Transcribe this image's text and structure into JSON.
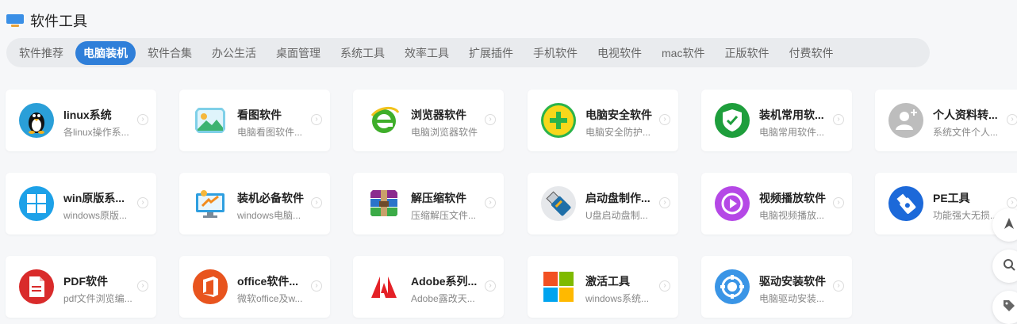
{
  "header": {
    "title": "软件工具",
    "icon": "monitor-icon"
  },
  "tabs": [
    {
      "label": "软件推荐",
      "active": false
    },
    {
      "label": "电脑装机",
      "active": true
    },
    {
      "label": "软件合集",
      "active": false
    },
    {
      "label": "办公生活",
      "active": false
    },
    {
      "label": "桌面管理",
      "active": false
    },
    {
      "label": "系统工具",
      "active": false
    },
    {
      "label": "效率工具",
      "active": false
    },
    {
      "label": "扩展插件",
      "active": false
    },
    {
      "label": "手机软件",
      "active": false
    },
    {
      "label": "电视软件",
      "active": false
    },
    {
      "label": "mac软件",
      "active": false
    },
    {
      "label": "正版软件",
      "active": false
    },
    {
      "label": "付费软件",
      "active": false
    }
  ],
  "cards": [
    {
      "name": "linux系统",
      "desc": "各linux操作系...",
      "icon": "linux-penguin-icon"
    },
    {
      "name": "看图软件",
      "desc": "电脑看图软件...",
      "icon": "image-viewer-icon"
    },
    {
      "name": "浏览器软件",
      "desc": "电脑浏览器软件",
      "icon": "browser-icon"
    },
    {
      "name": "电脑安全软件",
      "desc": "电脑安全防护...",
      "icon": "security-plus-icon"
    },
    {
      "name": "装机常用软...",
      "desc": "电脑常用软件...",
      "icon": "shield-check-icon"
    },
    {
      "name": "个人资料转...",
      "desc": "系统文件个人...",
      "icon": "user-profile-icon"
    },
    {
      "name": "win原版系...",
      "desc": "windows原版...",
      "icon": "windows-icon"
    },
    {
      "name": "装机必备软件",
      "desc": "windows电脑...",
      "icon": "install-essentials-icon"
    },
    {
      "name": "解压缩软件",
      "desc": "压缩解压文件...",
      "icon": "archive-icon"
    },
    {
      "name": "启动盘制作...",
      "desc": "U盘启动盘制...",
      "icon": "usb-drive-icon"
    },
    {
      "name": "视频播放软件",
      "desc": "电脑视频播放...",
      "icon": "video-play-icon"
    },
    {
      "name": "PE工具",
      "desc": "功能强大无损...",
      "icon": "pe-tool-icon"
    },
    {
      "name": "PDF软件",
      "desc": "pdf文件浏览编...",
      "icon": "pdf-icon"
    },
    {
      "name": "office软件...",
      "desc": "微软office及w...",
      "icon": "office-icon"
    },
    {
      "name": "Adobe系列...",
      "desc": "Adobe露改天...",
      "icon": "adobe-icon"
    },
    {
      "name": "激活工具",
      "desc": "windows系统...",
      "icon": "activation-icon"
    },
    {
      "name": "驱动安装软件",
      "desc": "电脑驱动安装...",
      "icon": "driver-install-icon"
    }
  ],
  "side_buttons": [
    {
      "icon": "back-to-top-icon"
    },
    {
      "icon": "search-icon"
    },
    {
      "icon": "tag-icon"
    }
  ],
  "colors": {
    "accent": "#2f7fd9",
    "page_bg": "#f6f7f9",
    "tabbar_bg": "#e9ebee"
  }
}
